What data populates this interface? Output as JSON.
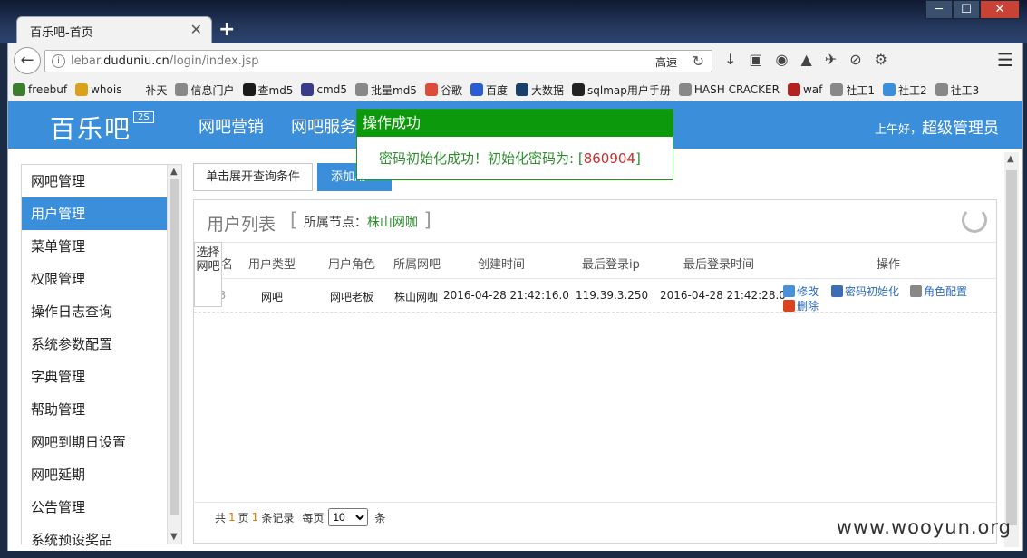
{
  "browser": {
    "tab_title": "百乐吧-首页",
    "tab_close": "✕",
    "new_tab": "+",
    "window_buttons": [
      "─",
      "☐",
      "✕"
    ],
    "url_info": "i",
    "url_prefix": "lebar.",
    "url_domain": "duduniu.cn",
    "url_path": "/login/index.jsp",
    "url_speed": "高速",
    "bookmarks": [
      {
        "label": "freebuf",
        "color": "#3b7e2f"
      },
      {
        "label": "whois",
        "color": "#d9a21a"
      },
      {
        "label": "补天",
        "color": "#f2f2f2"
      },
      {
        "label": "信息门户",
        "color": "#888888"
      },
      {
        "label": "查md5",
        "color": "#1a1a1a"
      },
      {
        "label": "cmd5",
        "color": "#3a3a8a"
      },
      {
        "label": "批量md5",
        "color": "#888888"
      },
      {
        "label": "谷歌",
        "color": "#dd4b39"
      },
      {
        "label": "百度",
        "color": "#2a5ecf"
      },
      {
        "label": "大数据",
        "color": "#1b3f6b"
      },
      {
        "label": "sqlmap用户手册",
        "color": "#222222"
      },
      {
        "label": "HASH CRACKER",
        "color": "#888888"
      },
      {
        "label": "waf",
        "color": "#b22222"
      },
      {
        "label": "社工1",
        "color": "#888888"
      },
      {
        "label": "社工2",
        "color": "#3b8ed9"
      },
      {
        "label": "社工3",
        "color": "#888888"
      }
    ]
  },
  "header": {
    "logo": "百乐吧",
    "logo_badge": "2S",
    "nav": [
      "网吧营销",
      "网吧服务"
    ],
    "greeting": "上午好，",
    "user": "超级管理员"
  },
  "sidebar": {
    "items": [
      {
        "label": "网吧管理",
        "active": false
      },
      {
        "label": "用户管理",
        "active": true
      },
      {
        "label": "菜单管理",
        "active": false
      },
      {
        "label": "权限管理",
        "active": false
      },
      {
        "label": "操作日志查询",
        "active": false
      },
      {
        "label": "系统参数配置",
        "active": false
      },
      {
        "label": "字典管理",
        "active": false
      },
      {
        "label": "帮助管理",
        "active": false
      },
      {
        "label": "网吧到期日设置",
        "active": false
      },
      {
        "label": "网吧延期",
        "active": false
      },
      {
        "label": "公告管理",
        "active": false
      },
      {
        "label": "系统预设奖品",
        "active": false
      }
    ]
  },
  "toolbar": {
    "expand_label": "单击展开查询条件",
    "add_label": "添加用"
  },
  "panel": {
    "title": "用户列表",
    "bracket_open": "[",
    "bracket_close": "]",
    "node_label": "所属节点：",
    "node_value": "株山网咖",
    "select_net": "选择网吧",
    "columns": [
      "名",
      "用户类型",
      "用户角色",
      "所属网吧",
      "创建时间",
      "最后登录ip",
      "最后登录时间",
      "操作"
    ],
    "rows": [
      {
        "name": "53",
        "type": "网吧",
        "role": "网吧老板",
        "cafe": "株山网咖",
        "created": "2016-04-28 21:42:16.0",
        "last_ip": "119.39.3.250",
        "last_login": "2016-04-28 21:42:28.0"
      }
    ],
    "ops": {
      "edit": "修改",
      "reset_password": "密码初始化",
      "role_config": "角色配置",
      "delete": "删除"
    }
  },
  "pager": {
    "total_prefix": "共",
    "pages": "1",
    "pages_suffix": "页",
    "records": "1",
    "records_suffix": "条记录",
    "per_page_label": "每页",
    "per_page": "10",
    "per_page_suffix": "条"
  },
  "toast": {
    "title": "操作成功",
    "message": "密码初始化成功！初始化密码为: [",
    "code": "860904",
    "message_end": "]"
  },
  "watermark": "www.wooyun.org",
  "colors": {
    "accent": "#3b8ed9",
    "success": "#0c9a0c",
    "code_red": "#c7302e"
  }
}
